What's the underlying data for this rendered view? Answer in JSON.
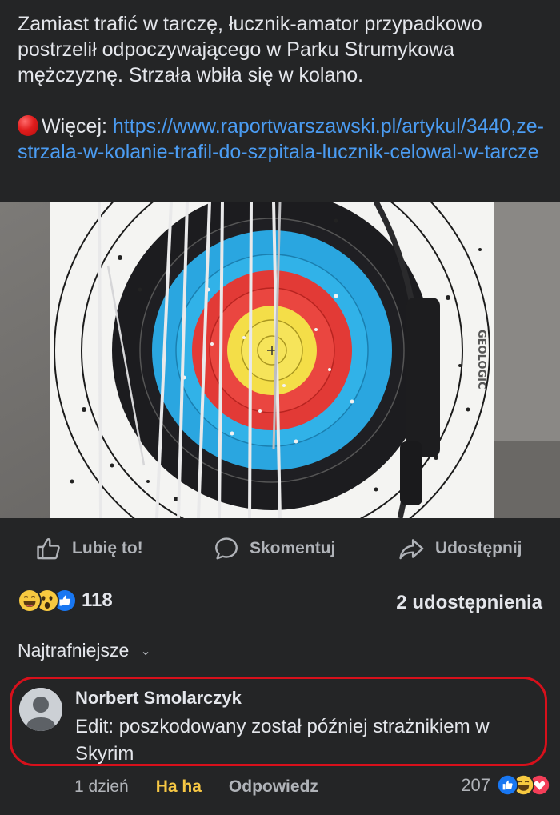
{
  "post": {
    "text": "Zamiast trafić w tarczę, łucznik-amator przypadkowo postrzelił odpoczywającego w Parku Strumykowa mężczyznę. Strzała wbiła się w kolano.",
    "more_label": "Więcej: ",
    "link": "https://www.raportwarszawski.pl/artykul/3440,ze-strzala-w-kolanie-trafil-do-szpitala-lucznik-celowal-w-tarcze",
    "image_brand_text": "GEOLOGIC"
  },
  "actions": {
    "like": "Lubię to!",
    "comment": "Skomentuj",
    "share": "Udostępnij"
  },
  "stats": {
    "reaction_count": "118",
    "reaction_icons": [
      "haha-icon",
      "wow-icon",
      "like-icon"
    ],
    "shares": "2 udostępnienia"
  },
  "comments_sort": {
    "label": "Najtrafniejsze"
  },
  "comment": {
    "author": "Norbert Smolarczyk",
    "text": "Edit: poszkodowany został później strażnikiem w Skyrim",
    "time": "1 dzień",
    "haha_label": "Ha ha",
    "reply_label": "Odpowiedz",
    "reaction_count": "207",
    "reaction_icons": [
      "like-icon",
      "haha-icon",
      "love-icon"
    ]
  },
  "colors": {
    "background": "#242526",
    "link": "#4b9cf2",
    "highlight_outline": "#d7101b",
    "haha_yellow": "#f6c744"
  }
}
